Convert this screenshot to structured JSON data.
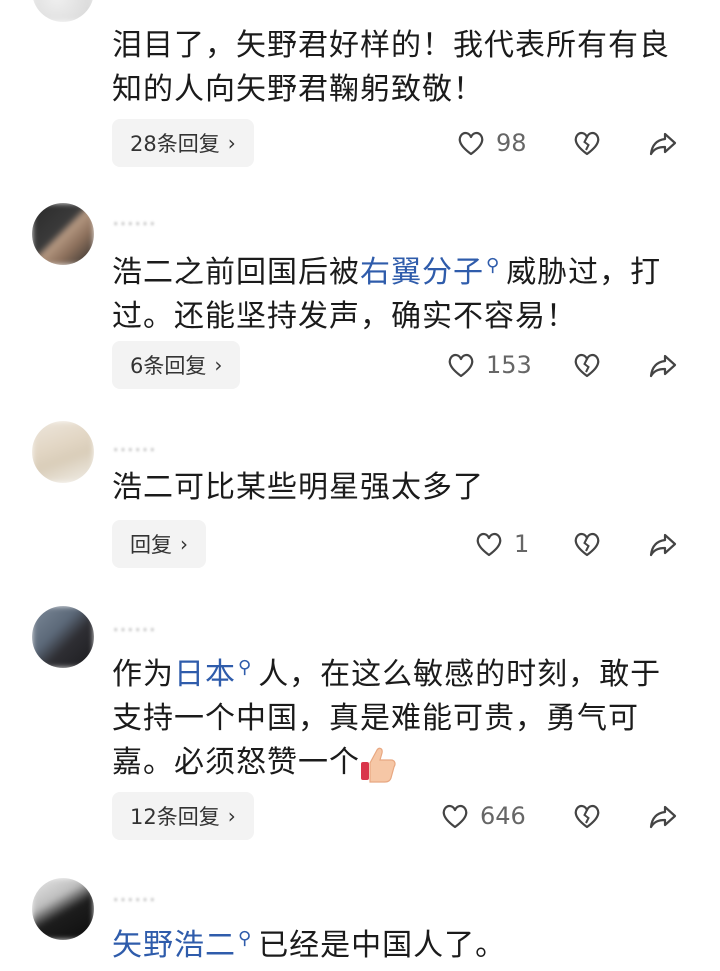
{
  "comments": [
    {
      "meta": "",
      "text_plain": "泪目了，矢野君好样的！我代表所有有良知的人向矢野君鞠躬致敬！",
      "reply_label": "28条回复",
      "likes": "98"
    },
    {
      "meta": "……",
      "text_pre": "浩二之前回国后被",
      "link_text": "右翼分子",
      "text_post": "威胁过，打过。还能坚持发声，确实不容易！",
      "reply_label": "6条回复",
      "likes": "153"
    },
    {
      "meta": "……",
      "text_plain": "浩二可比某些明星强太多了",
      "reply_label": "回复",
      "likes": "1"
    },
    {
      "meta": "……",
      "text_pre": "作为",
      "link_text": "日本",
      "text_post": "人，在这么敏感的时刻，敢于支持一个中国，真是难能可贵，勇气可嘉。必须怒赞一个",
      "reply_label": "12条回复",
      "likes": "646"
    },
    {
      "meta": "……",
      "link_text": "矢野浩二",
      "text_post": "已经是中国人了。"
    }
  ],
  "icons": {
    "like": "heart-icon",
    "dislike": "broken-heart-icon",
    "share": "share-icon",
    "search_mark": "search-icon",
    "emoji": "thumbs-up-emoji"
  },
  "colors": {
    "link": "#2f5cab",
    "text": "#1b1b1b",
    "pill_bg": "#f3f3f3"
  }
}
